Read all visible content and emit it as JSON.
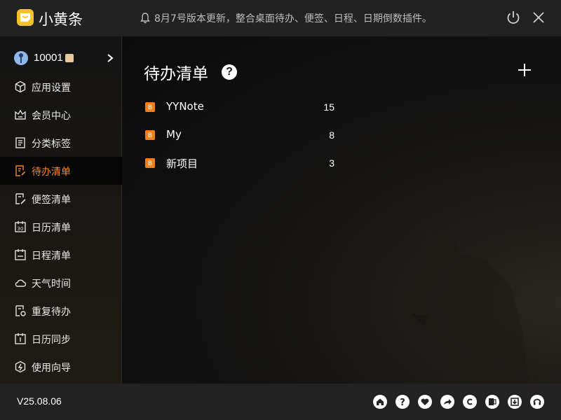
{
  "app": {
    "title": "小黄条"
  },
  "titlebar": {
    "notice": "8月7号版本更新，整合桌面待办、便签、日程、日期倒数插件。"
  },
  "user": {
    "id": "10001"
  },
  "sidebar": {
    "items": [
      {
        "label": "应用设置",
        "icon": "settings-cube-icon"
      },
      {
        "label": "会员中心",
        "icon": "member-crown-icon"
      },
      {
        "label": "分类标签",
        "icon": "tag-list-icon"
      },
      {
        "label": "待办清单",
        "icon": "todo-icon",
        "active": true
      },
      {
        "label": "便签清单",
        "icon": "note-edit-icon"
      },
      {
        "label": "日历清单",
        "icon": "calendar-30-icon"
      },
      {
        "label": "日程清单",
        "icon": "schedule-icon"
      },
      {
        "label": "天气时间",
        "icon": "weather-cloud-icon"
      },
      {
        "label": "重复待办",
        "icon": "repeat-icon"
      },
      {
        "label": "日历同步",
        "icon": "calendar-sync-icon"
      },
      {
        "label": "使用向导",
        "icon": "guide-icon"
      }
    ]
  },
  "main": {
    "title": "待办清单",
    "lists": [
      {
        "tag": "B",
        "name": "YYNote",
        "count": "15"
      },
      {
        "tag": "B",
        "name": "My",
        "count": "8"
      },
      {
        "tag": "B",
        "name": "新项目",
        "count": "3"
      }
    ]
  },
  "footer": {
    "version": "V25.08.06"
  },
  "colors": {
    "accent": "#f0892a",
    "logo": "#f6c22b",
    "tag": "#f07f1f"
  }
}
